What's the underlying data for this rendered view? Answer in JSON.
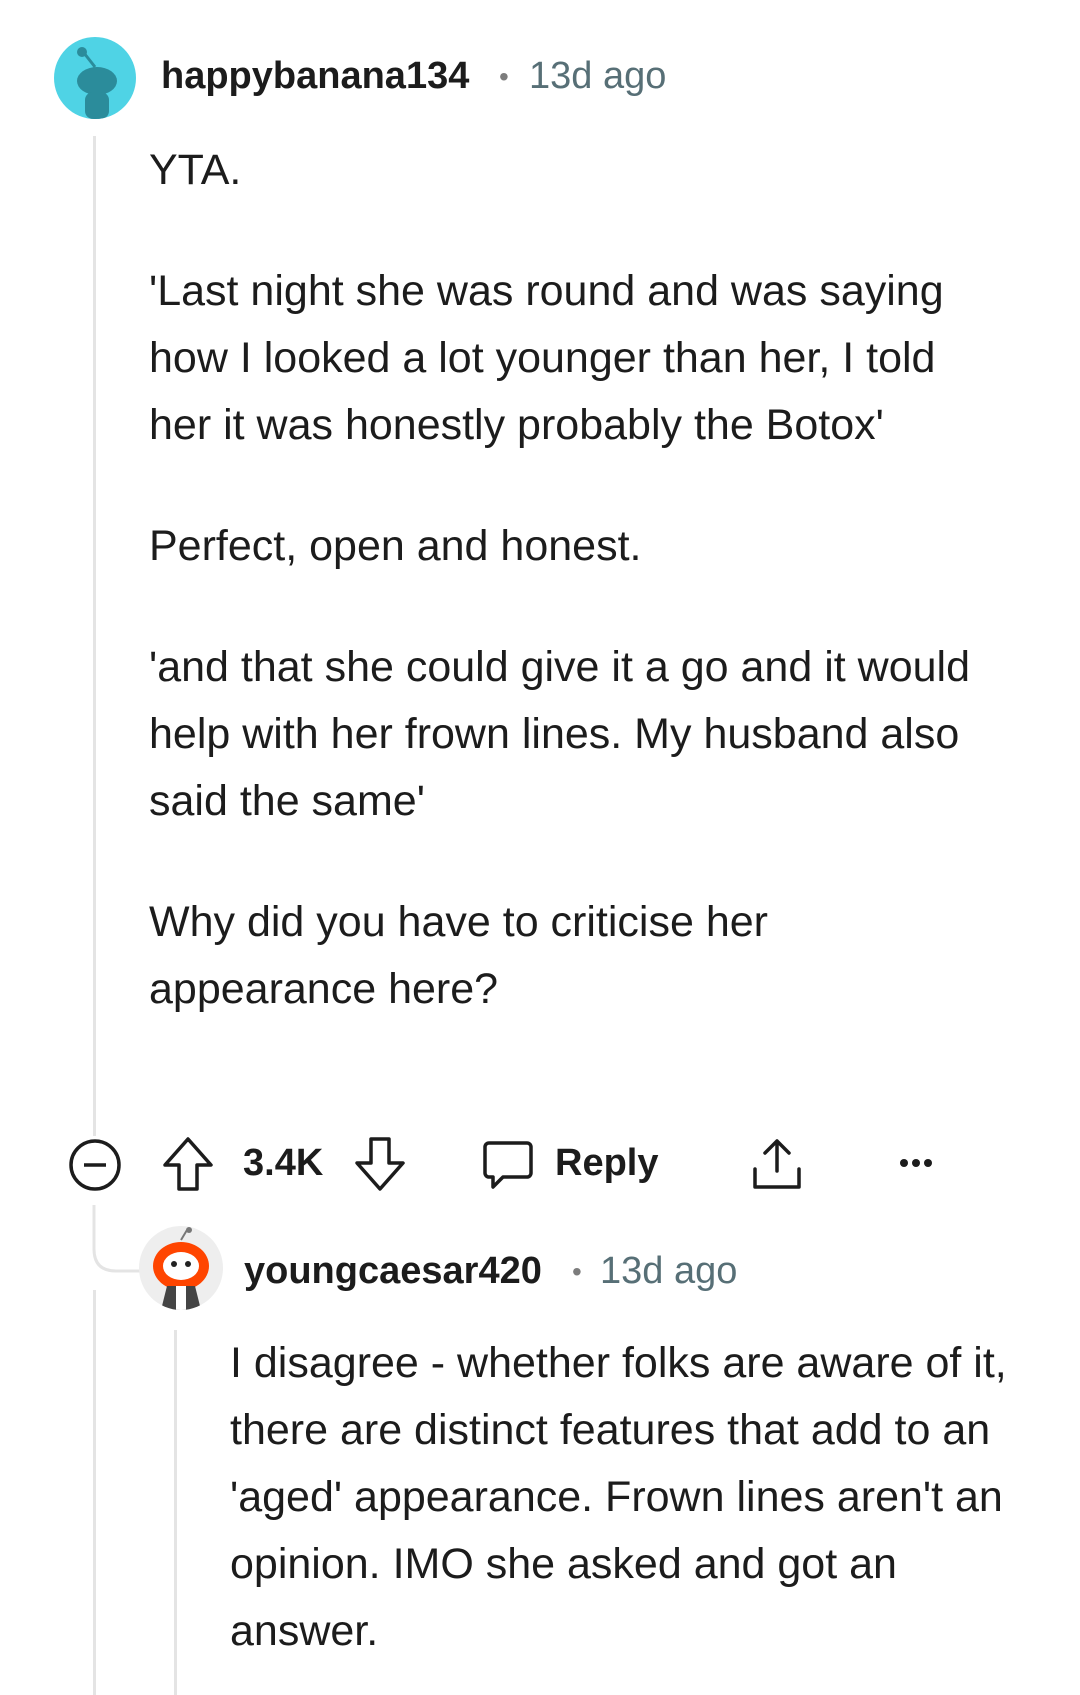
{
  "comments": [
    {
      "username": "happybanana134",
      "separator": "•",
      "age": "13d ago",
      "paragraphs": [
        "YTA.",
        "'Last night she was round and was saying how I looked a lot younger than her, I told her it was honestly probably the Botox'",
        "Perfect, open and honest.",
        "'and that she could give it a go and it would help with her frown lines. My husband also said the same'",
        "Why did you have to criticise her appearance here?"
      ],
      "actions": {
        "vote_count": "3.4K",
        "reply_label": "Reply",
        "icons": [
          "collapse-icon",
          "upvote-icon",
          "downvote-icon",
          "reply-icon",
          "share-icon",
          "more-icon"
        ]
      }
    },
    {
      "username": "youngcaesar420",
      "separator": "•",
      "age": "13d ago",
      "paragraphs": [
        "I disagree - whether folks are aware of it, there are distinct features that add to an 'aged' appearance. Frown lines aren't an opinion. IMO she asked and got an answer."
      ]
    }
  ],
  "colors": {
    "avatar1_bg": "#4fd3e5",
    "avatar2_orange": "#ff4500",
    "thread_line": "#e4e4e4",
    "meta_text": "#576f76"
  }
}
